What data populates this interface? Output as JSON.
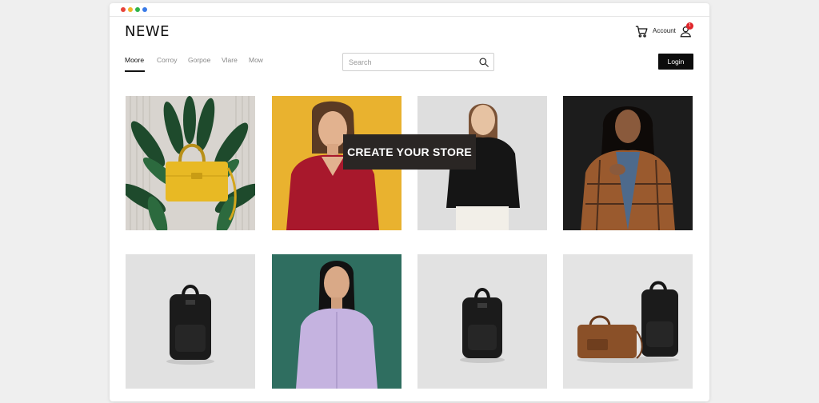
{
  "window": {
    "traffic_lights": [
      "#e8443a",
      "#f0b429",
      "#2fb44a",
      "#3a7be8"
    ]
  },
  "header": {
    "logo": "NEWE",
    "account_label": "Account",
    "notification_count": "1",
    "login_label": "Login"
  },
  "nav": {
    "items": [
      {
        "label": "Moore",
        "active": true
      },
      {
        "label": "Corroy",
        "active": false
      },
      {
        "label": "Gorpoe",
        "active": false
      },
      {
        "label": "Vlare",
        "active": false
      },
      {
        "label": "Mow",
        "active": false
      }
    ]
  },
  "search": {
    "placeholder": "Search",
    "value": ""
  },
  "banner": {
    "text": "CREATE YOUR STORE"
  },
  "colors": {
    "accent": "#0c0c0c",
    "badge": "#e0252a",
    "mustard": "#e9b22f",
    "teal": "#2f6e60"
  },
  "products": [
    {
      "image": "yellow-handbag-on-plants"
    },
    {
      "image": "woman-red-sweater"
    },
    {
      "image": "woman-black-knit"
    },
    {
      "image": "woman-plaid-coat"
    },
    {
      "image": "black-backpack"
    },
    {
      "image": "woman-lavender-shirt"
    },
    {
      "image": "black-backpack"
    },
    {
      "image": "brown-bag-and-backpack"
    }
  ]
}
